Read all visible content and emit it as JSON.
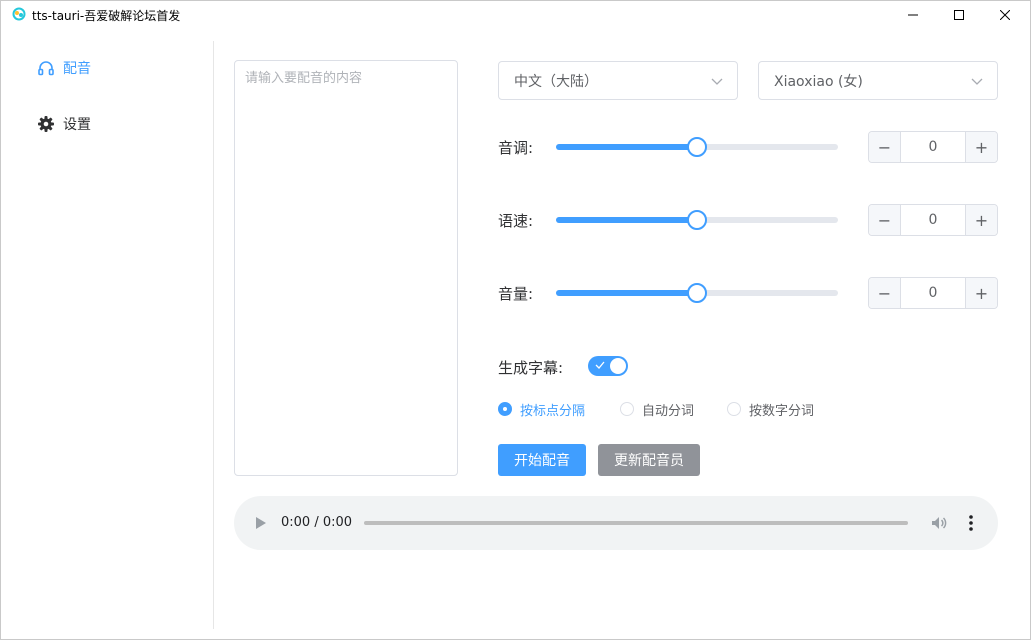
{
  "window": {
    "title": "tts-tauri-吾爱破解论坛首发"
  },
  "sidebar": {
    "items": [
      {
        "label": "配音",
        "icon": "headphones-icon",
        "active": true
      },
      {
        "label": "设置",
        "icon": "gear-icon",
        "active": false
      }
    ]
  },
  "editor": {
    "placeholder": "请输入要配音的内容",
    "value": ""
  },
  "selects": {
    "language": "中文（大陆）",
    "voice": "Xiaoxiao (女)"
  },
  "sliders": {
    "pitch": {
      "label": "音调:",
      "value": "0",
      "level": 0.5
    },
    "rate": {
      "label": "语速:",
      "value": "0",
      "level": 0.5
    },
    "volume": {
      "label": "音量:",
      "value": "0",
      "level": 0.5
    }
  },
  "subtitle": {
    "label": "生成字幕:",
    "enabled": true,
    "options": [
      {
        "label": "按标点分隔",
        "checked": true
      },
      {
        "label": "自动分词",
        "checked": false
      },
      {
        "label": "按数字分词",
        "checked": false
      }
    ]
  },
  "buttons": {
    "start": "开始配音",
    "update": "更新配音员"
  },
  "audio": {
    "time": "0:00 / 0:00",
    "progress": 0
  },
  "colors": {
    "primary": "#409eff",
    "secondary_button": "#909399",
    "border": "#dcdfe6"
  }
}
